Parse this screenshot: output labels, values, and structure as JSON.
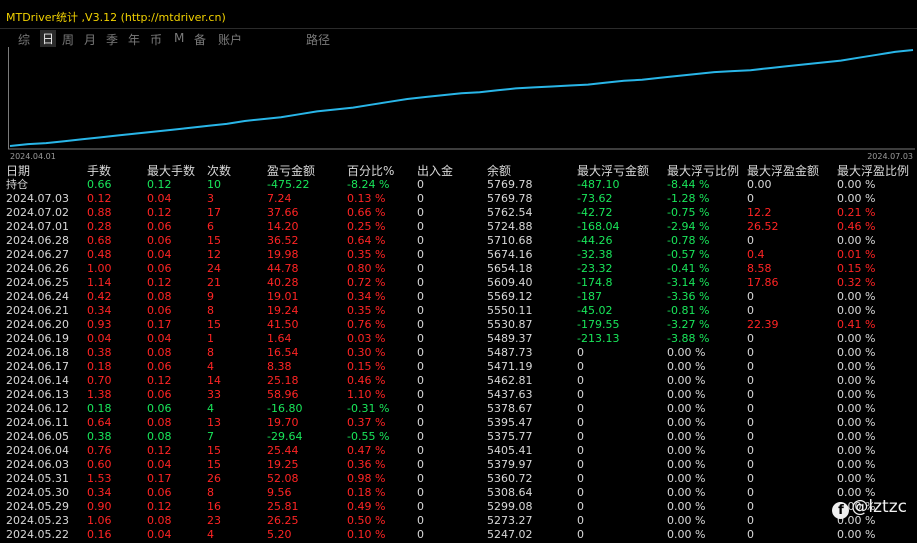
{
  "app": {
    "title": "MTDriver统计 ,V3.12 (http://mtdriver.cn)"
  },
  "tabs": [
    {
      "label": "综",
      "active": false
    },
    {
      "label": "日",
      "active": true
    },
    {
      "label": "周",
      "active": false
    },
    {
      "label": "月",
      "active": false
    },
    {
      "label": "季",
      "active": false
    },
    {
      "label": "年",
      "active": false
    },
    {
      "label": "币",
      "active": false
    },
    {
      "label": "M",
      "active": false
    },
    {
      "label": "备",
      "active": false
    },
    {
      "label": "账户",
      "active": false
    },
    {
      "label": "路径",
      "active": false
    }
  ],
  "chart": {
    "start_date": "2024.04.01",
    "end_date": "2024.07.03",
    "line_color": "#29b6e8",
    "curve": [
      0.0,
      0.02,
      0.03,
      0.05,
      0.07,
      0.09,
      0.11,
      0.13,
      0.15,
      0.17,
      0.19,
      0.21,
      0.23,
      0.26,
      0.28,
      0.3,
      0.33,
      0.36,
      0.38,
      0.4,
      0.43,
      0.46,
      0.49,
      0.51,
      0.53,
      0.55,
      0.56,
      0.58,
      0.6,
      0.61,
      0.62,
      0.63,
      0.64,
      0.66,
      0.68,
      0.69,
      0.71,
      0.73,
      0.75,
      0.77,
      0.78,
      0.79,
      0.81,
      0.83,
      0.85,
      0.87,
      0.89,
      0.92,
      0.95,
      0.98,
      1.0
    ]
  },
  "colors": {
    "pos": "#19e65a",
    "neg": "#ff2424",
    "neutral": "#d8d8d8"
  },
  "table": {
    "headers": [
      "日期",
      "手数",
      "最大手数",
      "次数",
      "盈亏金额",
      "百分比%",
      "出入金",
      "余额",
      "最大浮亏金额",
      "最大浮亏比例",
      "最大浮盈金额",
      "最大浮盈比例"
    ],
    "holding": [
      "持仓",
      "0.66",
      "0.12",
      "10",
      "-475.22",
      "-8.24 %",
      "0",
      "5769.78",
      "-487.10",
      "-8.44 %",
      "0.00",
      "0.00 %"
    ],
    "rows": [
      [
        "2024.07.03",
        "0.12",
        "0.04",
        "3",
        "7.24",
        "0.13 %",
        "0",
        "5769.78",
        "-73.62",
        "-1.28 %",
        "0",
        "0.00 %"
      ],
      [
        "2024.07.02",
        "0.88",
        "0.12",
        "17",
        "37.66",
        "0.66 %",
        "0",
        "5762.54",
        "-42.72",
        "-0.75 %",
        "12.2",
        "0.21 %"
      ],
      [
        "2024.07.01",
        "0.28",
        "0.06",
        "6",
        "14.20",
        "0.25 %",
        "0",
        "5724.88",
        "-168.04",
        "-2.94 %",
        "26.52",
        "0.46 %"
      ],
      [
        "2024.06.28",
        "0.68",
        "0.06",
        "15",
        "36.52",
        "0.64 %",
        "0",
        "5710.68",
        "-44.26",
        "-0.78 %",
        "0",
        "0.00 %"
      ],
      [
        "2024.06.27",
        "0.48",
        "0.04",
        "12",
        "19.98",
        "0.35 %",
        "0",
        "5674.16",
        "-32.38",
        "-0.57 %",
        "0.4",
        "0.01 %"
      ],
      [
        "2024.06.26",
        "1.00",
        "0.06",
        "24",
        "44.78",
        "0.80 %",
        "0",
        "5654.18",
        "-23.32",
        "-0.41 %",
        "8.58",
        "0.15 %"
      ],
      [
        "2024.06.25",
        "1.14",
        "0.12",
        "21",
        "40.28",
        "0.72 %",
        "0",
        "5609.40",
        "-174.8",
        "-3.14 %",
        "17.86",
        "0.32 %"
      ],
      [
        "2024.06.24",
        "0.42",
        "0.08",
        "9",
        "19.01",
        "0.34 %",
        "0",
        "5569.12",
        "-187",
        "-3.36 %",
        "0",
        "0.00 %"
      ],
      [
        "2024.06.21",
        "0.34",
        "0.06",
        "8",
        "19.24",
        "0.35 %",
        "0",
        "5550.11",
        "-45.02",
        "-0.81 %",
        "0",
        "0.00 %"
      ],
      [
        "2024.06.20",
        "0.93",
        "0.17",
        "15",
        "41.50",
        "0.76 %",
        "0",
        "5530.87",
        "-179.55",
        "-3.27 %",
        "22.39",
        "0.41 %"
      ],
      [
        "2024.06.19",
        "0.04",
        "0.04",
        "1",
        "1.64",
        "0.03 %",
        "0",
        "5489.37",
        "-213.13",
        "-3.88 %",
        "0",
        "0.00 %"
      ],
      [
        "2024.06.18",
        "0.38",
        "0.08",
        "8",
        "16.54",
        "0.30 %",
        "0",
        "5487.73",
        "0",
        "0.00 %",
        "0",
        "0.00 %"
      ],
      [
        "2024.06.17",
        "0.18",
        "0.06",
        "4",
        "8.38",
        "0.15 %",
        "0",
        "5471.19",
        "0",
        "0.00 %",
        "0",
        "0.00 %"
      ],
      [
        "2024.06.14",
        "0.70",
        "0.12",
        "14",
        "25.18",
        "0.46 %",
        "0",
        "5462.81",
        "0",
        "0.00 %",
        "0",
        "0.00 %"
      ],
      [
        "2024.06.13",
        "1.38",
        "0.06",
        "33",
        "58.96",
        "1.10 %",
        "0",
        "5437.63",
        "0",
        "0.00 %",
        "0",
        "0.00 %"
      ],
      [
        "2024.06.12",
        "0.18",
        "0.06",
        "4",
        "-16.80",
        "-0.31 %",
        "0",
        "5378.67",
        "0",
        "0.00 %",
        "0",
        "0.00 %"
      ],
      [
        "2024.06.11",
        "0.64",
        "0.08",
        "13",
        "19.70",
        "0.37 %",
        "0",
        "5395.47",
        "0",
        "0.00 %",
        "0",
        "0.00 %"
      ],
      [
        "2024.06.05",
        "0.38",
        "0.08",
        "7",
        "-29.64",
        "-0.55 %",
        "0",
        "5375.77",
        "0",
        "0.00 %",
        "0",
        "0.00 %"
      ],
      [
        "2024.06.04",
        "0.76",
        "0.12",
        "15",
        "25.44",
        "0.47 %",
        "0",
        "5405.41",
        "0",
        "0.00 %",
        "0",
        "0.00 %"
      ],
      [
        "2024.06.03",
        "0.60",
        "0.04",
        "15",
        "19.25",
        "0.36 %",
        "0",
        "5379.97",
        "0",
        "0.00 %",
        "0",
        "0.00 %"
      ],
      [
        "2024.05.31",
        "1.53",
        "0.17",
        "26",
        "52.08",
        "0.98 %",
        "0",
        "5360.72",
        "0",
        "0.00 %",
        "0",
        "0.00 %"
      ],
      [
        "2024.05.30",
        "0.34",
        "0.06",
        "8",
        "9.56",
        "0.18 %",
        "0",
        "5308.64",
        "0",
        "0.00 %",
        "0",
        "0.00 %"
      ],
      [
        "2024.05.29",
        "0.90",
        "0.12",
        "16",
        "25.81",
        "0.49 %",
        "0",
        "5299.08",
        "0",
        "0.00 %",
        "0",
        "0.00 %"
      ],
      [
        "2024.05.23",
        "1.06",
        "0.08",
        "23",
        "26.25",
        "0.50 %",
        "0",
        "5273.27",
        "0",
        "0.00 %",
        "0",
        "0.00 %"
      ],
      [
        "2024.05.22",
        "0.16",
        "0.04",
        "4",
        "5.20",
        "0.10 %",
        "0",
        "5247.02",
        "0",
        "0.00 %",
        "0",
        "0.00 %"
      ]
    ]
  },
  "watermark": {
    "icon": "facebook-icon",
    "text": "@lztzc"
  }
}
